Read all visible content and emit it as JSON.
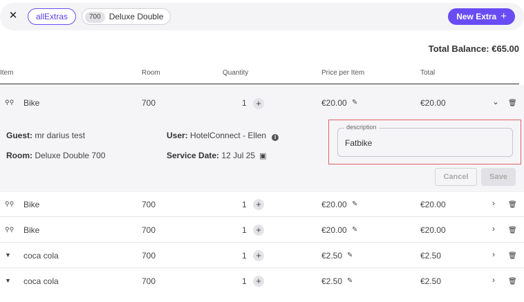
{
  "header": {
    "close_label": "✕",
    "chip_all": "allExtras",
    "room_number": "700",
    "room_name": "Deluxe Double",
    "new_extra_label": "New Extra",
    "new_extra_plus": "+"
  },
  "balance": {
    "text": "Total Balance: €65.00"
  },
  "table": {
    "columns": {
      "item": "Item",
      "room": "Room",
      "quantity": "Quantity",
      "price": "Price per Item",
      "total": "Total"
    },
    "rows": [
      {
        "icon": "bike-icon",
        "glyph": "⚲⚲",
        "item": "Bike",
        "room": "700",
        "quantity": "1",
        "price": "€20.00",
        "total": "€20.00",
        "chevron": "⌄"
      },
      {
        "icon": "bike-icon",
        "glyph": "⚲⚲",
        "item": "Bike",
        "room": "700",
        "quantity": "1",
        "price": "€20.00",
        "total": "€20.00",
        "chevron": "›"
      },
      {
        "icon": "bike-icon",
        "glyph": "⚲⚲",
        "item": "Bike",
        "room": "700",
        "quantity": "1",
        "price": "€20.00",
        "total": "€20.00",
        "chevron": "›"
      },
      {
        "icon": "cup-icon",
        "glyph": "▼",
        "item": "coca cola",
        "room": "700",
        "quantity": "1",
        "price": "€2.50",
        "total": "€2.50",
        "chevron": "›"
      },
      {
        "icon": "cup-icon",
        "glyph": "▼",
        "item": "coca cola",
        "room": "700",
        "quantity": "1",
        "price": "€2.50",
        "total": "€2.50",
        "chevron": "›"
      }
    ]
  },
  "details": {
    "guest_label": "Guest:",
    "guest_value": "mr darius test",
    "room_label": "Room:",
    "room_value": "Deluxe Double 700",
    "user_label": "User:",
    "user_value": "HotelConnect - Ellen",
    "service_label": "Service Date:",
    "service_value": "12 Jul 25",
    "description_label": "description",
    "description_value": "Fatbike",
    "cancel_label": "Cancel",
    "save_label": "Save"
  },
  "icons": {
    "plus": "+",
    "pencil": "✎",
    "trash": "🗑",
    "info": "i",
    "calendar": "▣"
  },
  "colors": {
    "accent": "#6a4cf5",
    "highlight_border": "#e06060"
  }
}
